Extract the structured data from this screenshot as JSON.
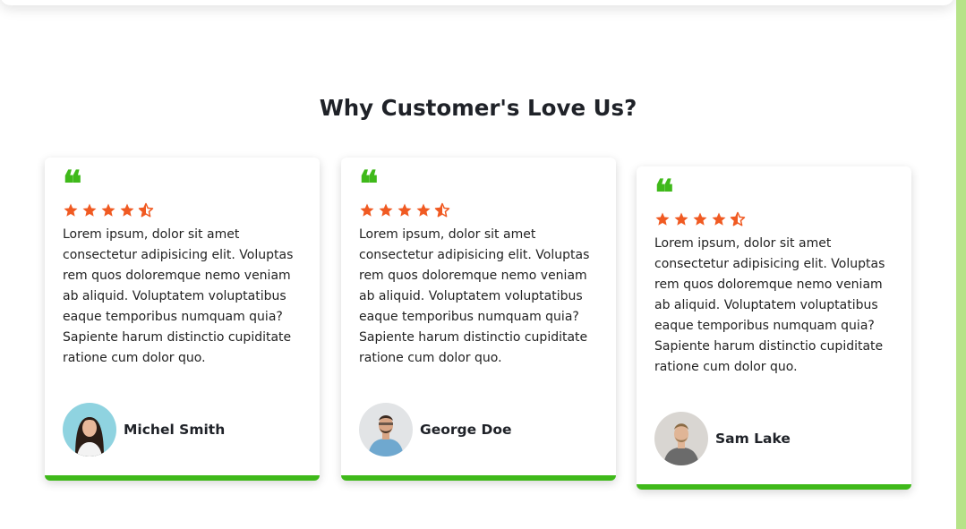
{
  "section": {
    "title": "Why Customer's Love Us?"
  },
  "colors": {
    "accent": "#3fb91a",
    "star": "#f05a22",
    "side_strip": "#b6e388"
  },
  "testimonials": [
    {
      "quote_icon": "quote-icon",
      "rating": 4.5,
      "text": "Lorem ipsum, dolor sit amet consectetur adipisicing elit. Voluptas rem quos doloremque nemo veniam ab aliquid. Voluptatem voluptatibus eaque temporibus numquam quia? Sapiente harum distinctio cupiditate ratione cum dolor quo.",
      "name": "Michel Smith"
    },
    {
      "quote_icon": "quote-icon",
      "rating": 4.5,
      "text": "Lorem ipsum, dolor sit amet consectetur adipisicing elit. Voluptas rem quos doloremque nemo veniam ab aliquid. Voluptatem voluptatibus eaque temporibus numquam quia? Sapiente harum distinctio cupiditate ratione cum dolor quo.",
      "name": "George Doe"
    },
    {
      "quote_icon": "quote-icon",
      "rating": 4.5,
      "text": "Lorem ipsum, dolor sit amet consectetur adipisicing elit. Voluptas rem quos doloremque nemo veniam ab aliquid. Voluptatem voluptatibus eaque temporibus numquam quia? Sapiente harum distinctio cupiditate ratione cum dolor quo.",
      "name": "Sam Lake"
    }
  ]
}
